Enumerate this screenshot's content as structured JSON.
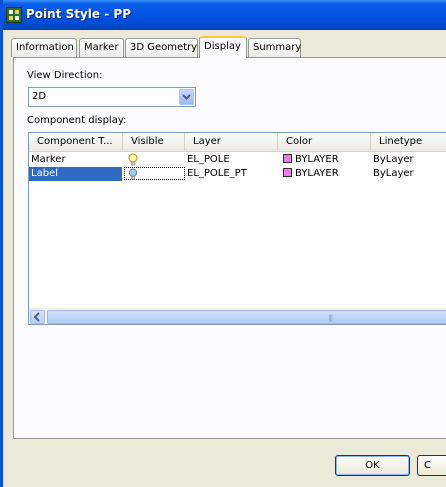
{
  "window": {
    "title": "Point Style - PP"
  },
  "tabs": [
    {
      "label": "Information"
    },
    {
      "label": "Marker"
    },
    {
      "label": "3D Geometry"
    },
    {
      "label": "Display"
    },
    {
      "label": "Summary"
    }
  ],
  "active_tab": "Display",
  "view_direction": {
    "label": "View Direction:",
    "value": "2D"
  },
  "component_display": {
    "label": "Component display:",
    "columns": [
      "Component T...",
      "Visible",
      "Layer",
      "Color",
      "Linetype"
    ],
    "rows": [
      {
        "component": "Marker",
        "visible": true,
        "layer": "EL_POLE",
        "color": "BYLAYER",
        "linetype": "ByLayer"
      },
      {
        "component": "Label",
        "visible": true,
        "layer": "EL_POLE_PT",
        "color": "BYLAYER",
        "linetype": "ByLayer",
        "selected": true
      }
    ],
    "color_swatch": "#e47fe4"
  },
  "buttons": {
    "ok": "OK",
    "cancel": "C"
  },
  "colors": {
    "title_bar": "#0054e3",
    "selection": "#316ac5",
    "active_tab_accent": "#ffc73c"
  }
}
